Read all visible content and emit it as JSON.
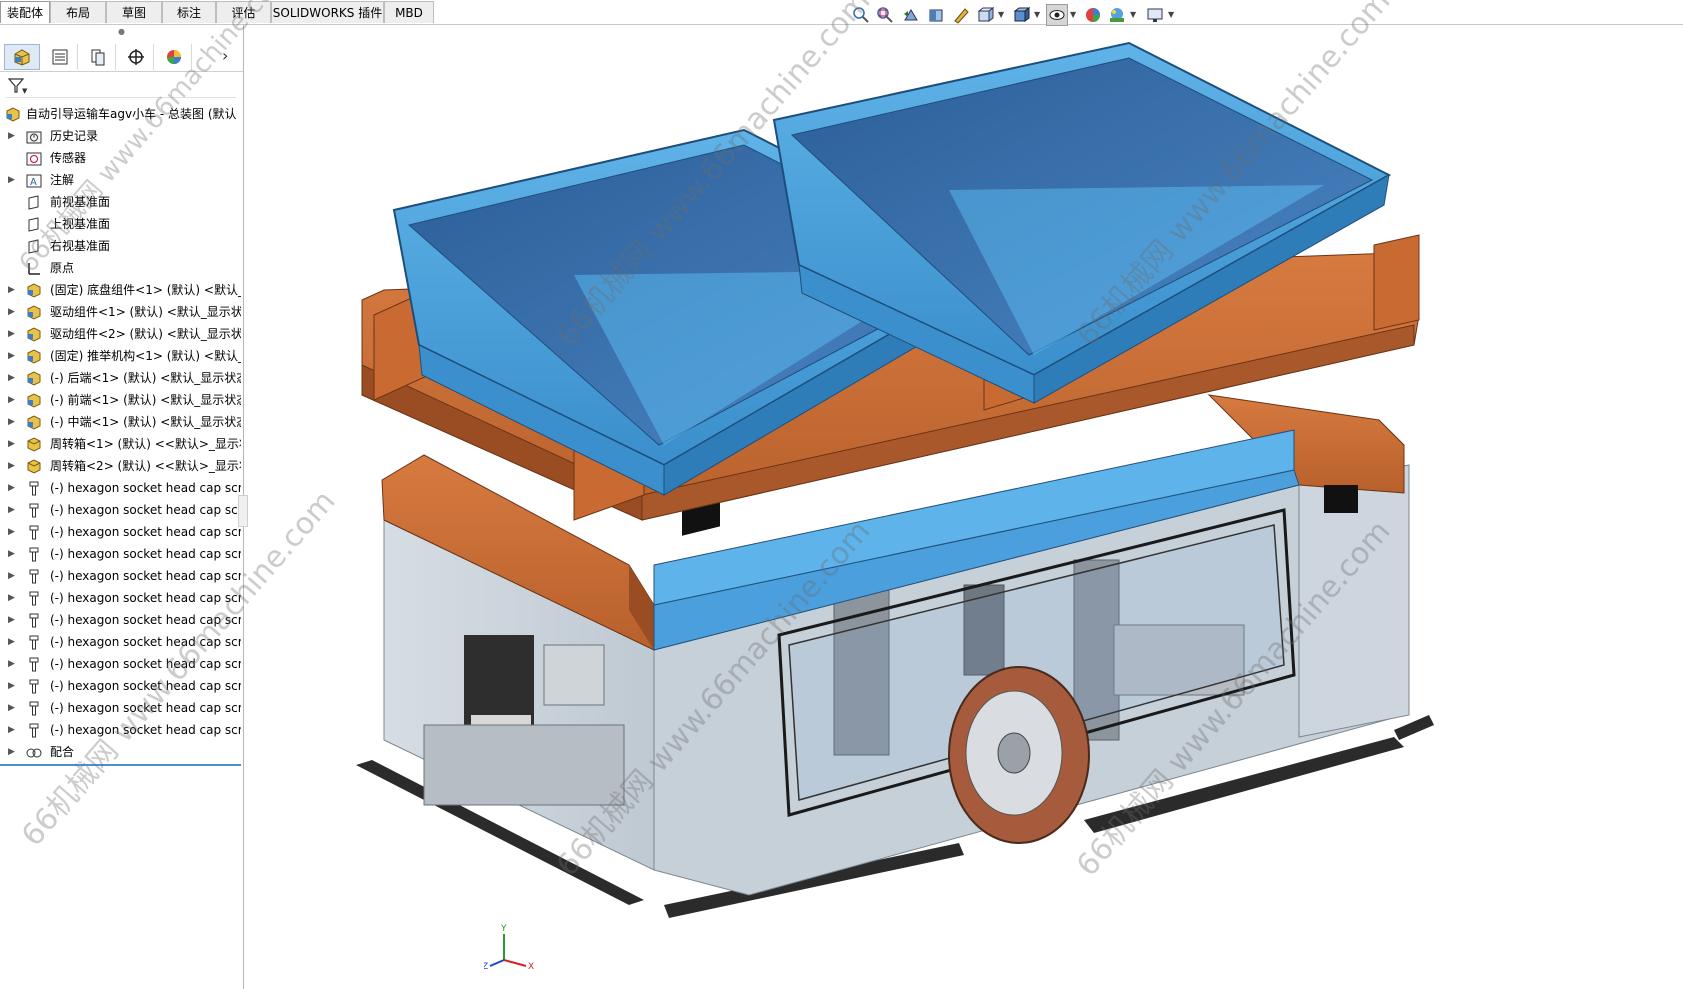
{
  "tabs": [
    {
      "label": "装配体",
      "active": true
    },
    {
      "label": "布局"
    },
    {
      "label": "草图"
    },
    {
      "label": "标注"
    },
    {
      "label": "评估"
    },
    {
      "label": "SOLIDWORKS 插件"
    },
    {
      "label": "MBD"
    }
  ],
  "hud_icons": [
    "zoom-to-fit-icon",
    "zoom-to-area-icon",
    "previous-view-icon",
    "section-view-icon",
    "dynamic-annotation-icon",
    "view-orientation-icon",
    "display-style-icon",
    "hide-show-items-icon",
    "edit-appearance-icon",
    "apply-scene-icon",
    "view-settings-icon",
    "display-settings-icon"
  ],
  "panel_tabs": [
    "featuremanager-tree-icon",
    "propertymanager-icon",
    "configurationmanager-icon",
    "dimxpertmanager-icon",
    "displaymanager-icon"
  ],
  "tree": {
    "root": "自动引导运输车agv小车 - 总装图 (默认",
    "items": [
      {
        "label": "历史记录",
        "icon": "history-folder-icon",
        "expand": true
      },
      {
        "label": "传感器",
        "icon": "sensor-icon",
        "expand": false
      },
      {
        "label": "注解",
        "icon": "annotation-icon",
        "expand": true
      },
      {
        "label": "前视基准面",
        "icon": "plane-icon",
        "expand": false
      },
      {
        "label": "上视基准面",
        "icon": "plane-icon",
        "expand": false
      },
      {
        "label": "右视基准面",
        "icon": "plane-icon",
        "expand": false
      },
      {
        "label": "原点",
        "icon": "origin-icon",
        "expand": false
      },
      {
        "label": "(固定) 底盘组件<1> (默认) <默认_显",
        "icon": "subassembly-icon",
        "expand": true
      },
      {
        "label": "驱动组件<1> (默认) <默认_显示状",
        "icon": "subassembly-icon",
        "expand": true
      },
      {
        "label": "驱动组件<2> (默认) <默认_显示状",
        "icon": "subassembly-icon",
        "expand": true
      },
      {
        "label": "(固定) 推举机构<1> (默认) <默认_显",
        "icon": "subassembly-icon",
        "expand": true
      },
      {
        "label": "(-) 后端<1> (默认) <默认_显示状态",
        "icon": "subassembly-icon",
        "expand": true
      },
      {
        "label": "(-) 前端<1> (默认) <默认_显示状态",
        "icon": "subassembly-icon",
        "expand": true
      },
      {
        "label": "(-) 中端<1> (默认) <默认_显示状态",
        "icon": "subassembly-icon",
        "expand": true
      },
      {
        "label": "周转箱<1> (默认) <<默认>_显示状",
        "icon": "part-icon",
        "expand": true
      },
      {
        "label": "周转箱<2> (默认) <<默认>_显示状",
        "icon": "part-icon",
        "expand": true
      },
      {
        "label": "(-) hexagon socket head cap scr",
        "icon": "screw-part-icon",
        "expand": true
      },
      {
        "label": "(-) hexagon socket head cap scr",
        "icon": "screw-part-icon",
        "expand": true
      },
      {
        "label": "(-) hexagon socket head cap scr",
        "icon": "screw-part-icon",
        "expand": true
      },
      {
        "label": "(-) hexagon socket head cap scr",
        "icon": "screw-part-icon",
        "expand": true
      },
      {
        "label": "(-) hexagon socket head cap scr",
        "icon": "screw-part-icon",
        "expand": true
      },
      {
        "label": "(-) hexagon socket head cap scr",
        "icon": "screw-part-icon",
        "expand": true
      },
      {
        "label": "(-) hexagon socket head cap scr",
        "icon": "screw-part-icon",
        "expand": true
      },
      {
        "label": "(-) hexagon socket head cap scr",
        "icon": "screw-part-icon",
        "expand": true
      },
      {
        "label": "(-) hexagon socket head cap scr",
        "icon": "screw-part-icon",
        "expand": true
      },
      {
        "label": "(-) hexagon socket head cap scr",
        "icon": "screw-part-icon",
        "expand": true
      },
      {
        "label": "(-) hexagon socket head cap scr",
        "icon": "screw-part-icon",
        "expand": true
      },
      {
        "label": "(-) hexagon socket head cap scr",
        "icon": "screw-part-icon",
        "expand": true
      },
      {
        "label": "配合",
        "icon": "mates-icon",
        "expand": true
      }
    ]
  },
  "watermarks": [
    "66机械网 www.66machine.com",
    "66机械网 www.66machine.com",
    "66机械网 www.66machine.com",
    "66机械网 www.66machine.com",
    "66机械网 www.66machine.com",
    "66机械网 www.66machine.com"
  ],
  "triad": {
    "y": "Y",
    "x": "X",
    "z": "Z"
  },
  "colors": {
    "bin_blue": "#4ea6de",
    "bin_dark": "#2f66a3",
    "frame_orange": "#c86a32",
    "frame_dark": "#8a4420",
    "glass": "#cfd8e0",
    "panel_accent": "#3d82c4"
  }
}
